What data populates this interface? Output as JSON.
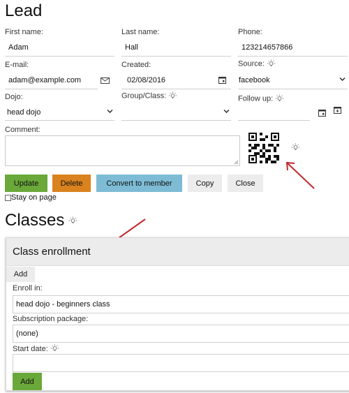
{
  "lead": {
    "title": "Lead",
    "first_name": {
      "label": "First name:",
      "value": "Adam"
    },
    "last_name": {
      "label": "Last name:",
      "value": "Hall"
    },
    "phone": {
      "label": "Phone:",
      "value": "123214657866"
    },
    "email": {
      "label": "E-mail:",
      "value": "adam@example.com"
    },
    "created": {
      "label": "Created:",
      "value": "02/08/2016"
    },
    "source": {
      "label": "Source:",
      "value": "facebook"
    },
    "dojo": {
      "label": "Dojo:",
      "value": "head dojo"
    },
    "group_class": {
      "label": "Group/Class:",
      "value": ""
    },
    "follow_up": {
      "label": "Follow up:",
      "value": ""
    },
    "comment": {
      "label": "Comment:",
      "value": ""
    }
  },
  "actions": {
    "update": "Update",
    "delete": "Delete",
    "convert": "Convert to member",
    "copy": "Copy",
    "close": "Close",
    "stay_on_page": "Stay on page"
  },
  "classes": {
    "title": "Classes",
    "panel_title": "Class enrollment",
    "add_tab": "Add",
    "enroll_in": {
      "label": "Enroll in:",
      "value": "head dojo - beginners class"
    },
    "subscription": {
      "label": "Subscription package:",
      "value": "(none)"
    },
    "start_date": {
      "label": "Start date:",
      "value": ""
    },
    "add_button": "Add"
  },
  "colors": {
    "update": "#6aa83a",
    "delete": "#d9821e",
    "convert": "#7dbcd4",
    "neutral": "#ececec",
    "arrow": "#c0282d"
  },
  "icons": [
    "bulb-icon",
    "calendar-icon",
    "mail-icon",
    "chevron-down-icon",
    "qr-code-icon",
    "arrow-annotation"
  ]
}
